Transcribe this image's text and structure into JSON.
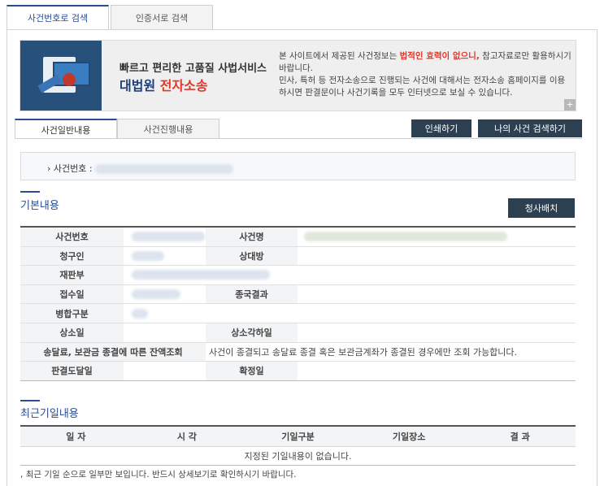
{
  "top_tabs": [
    "사건번호로 검색",
    "인증서로 검색"
  ],
  "banner": {
    "title1": "빠르고 편리한 고품질 사법서비스",
    "title2_a": "대법원 ",
    "title2_b": "전자소송",
    "text_pre": "본 사이트에서 제공된 사건정보는 ",
    "text_warn": "법적인 효력이 없으니,",
    "text_post": " 참고자료로만 활용하시기 바랍니다.",
    "text_line2": "민사, 특허 등 전자소송으로 진행되는 사건에 대해서는 전자소송 홈페이지를 이용하시면 판결문이나 사건기록을 모두 인터넷으로 보실 수 있습니다.",
    "plus": "+"
  },
  "sub_tabs": [
    "사건일반내용",
    "사건진행내용"
  ],
  "buttons": {
    "print": "인쇄하기",
    "my_case": "나의 사건 검색하기",
    "send": "청사배치"
  },
  "case_label": "사건번호 :",
  "basic": {
    "title": "기본내용",
    "rows": [
      {
        "h1": "사건번호",
        "h2": "사건명",
        "v2": ""
      },
      {
        "h1": "청구인",
        "h2": "상대방",
        "v2": ""
      },
      {
        "h1": "재판부"
      },
      {
        "h1": "접수일",
        "h2": "종국결과",
        "v2": ""
      },
      {
        "h1": "병합구분"
      },
      {
        "h1": "상소일",
        "h2": "상소각하일",
        "v2": ""
      },
      {
        "h1": "송달료, 보관금 종결에 따른 잔액조회",
        "wide": "사건이 종결되고 송달료 종결 혹은 보관금계좌가 종결된 경우에만 조회 가능합니다."
      },
      {
        "h1": "판결도달일",
        "h2": "확정일",
        "v2": ""
      }
    ]
  },
  "recent": {
    "title": "최근기일내용",
    "headers": [
      "일 자",
      "시 각",
      "기일구분",
      "기일장소",
      "결 과"
    ],
    "empty": "지정된 기일내용이 없습니다.",
    "note": "최근 기일 순으로 일부만 보입니다. 반드시 상세보기로 확인하시기 바랍니다."
  }
}
